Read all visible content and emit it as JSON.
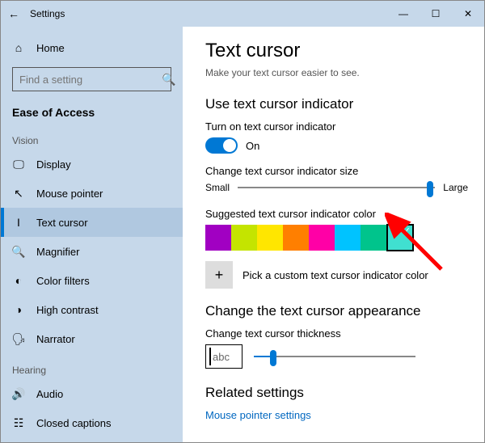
{
  "titlebar": {
    "back": "←",
    "title": "Settings",
    "min": "—",
    "max": "☐",
    "close": "✕"
  },
  "sidebar": {
    "home": "Home",
    "search_placeholder": "Find a setting",
    "heading": "Ease of Access",
    "groups": {
      "vision": "Vision",
      "hearing": "Hearing"
    },
    "items": {
      "display": "Display",
      "mouse_pointer": "Mouse pointer",
      "text_cursor": "Text cursor",
      "magnifier": "Magnifier",
      "color_filters": "Color filters",
      "high_contrast": "High contrast",
      "narrator": "Narrator",
      "audio": "Audio",
      "closed_captions": "Closed captions"
    }
  },
  "main": {
    "title": "Text cursor",
    "subtitle": "Make your text cursor easier to see.",
    "section_indicator": "Use text cursor indicator",
    "toggle_label": "Turn on text cursor indicator",
    "toggle_state": "On",
    "size_label": "Change text cursor indicator size",
    "size_small": "Small",
    "size_large": "Large",
    "color_label": "Suggested text cursor indicator color",
    "colors": [
      "#A100C2",
      "#C4E400",
      "#FFE600",
      "#FF7F00",
      "#FF00A6",
      "#00C3FF",
      "#00C48C",
      "#40E0D0"
    ],
    "selected_color_index": 7,
    "custom_label": "Pick a custom text cursor indicator color",
    "section_appearance": "Change the text cursor appearance",
    "thickness_label": "Change text cursor thickness",
    "preview_text": "abc",
    "section_related": "Related settings",
    "link_mouse": "Mouse pointer settings"
  }
}
